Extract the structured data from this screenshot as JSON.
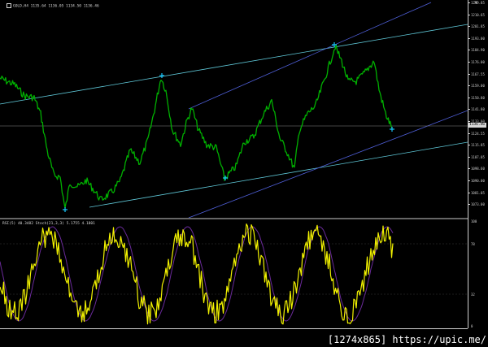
{
  "chart": {
    "title": "GOLD,H4  1135.64 1136.05 1134.50 1136.46",
    "bid_label": "1136.46",
    "close_glyph": "✕",
    "price_ticks": [
      "1219.85",
      "1210.65",
      "1201.85",
      "1193.00",
      "1184.90",
      "1176.00",
      "1167.55",
      "1159.00",
      "1150.80",
      "1141.80",
      "1133.00",
      "1124.55",
      "1115.85",
      "1107.05",
      "1098.60",
      "1090.00",
      "1081.05",
      "1073.00"
    ]
  },
  "indicator": {
    "title": "RSI(5) 40.3482  Stoch(21,3,3) 5.1755 4.1801",
    "ticks": [
      "100",
      "78",
      "32",
      "0"
    ]
  },
  "colors": {
    "background": "#000000",
    "price_line": "#00b000",
    "trendline_cyan": "#5fc8d8",
    "trendline_blue": "#4f5fd8",
    "rsi_line": "#f2f200",
    "stoch_line": "#6a2a9a",
    "arrow": "#18c8ff"
  },
  "watermark": "[1274x865] https://upic.me/"
}
